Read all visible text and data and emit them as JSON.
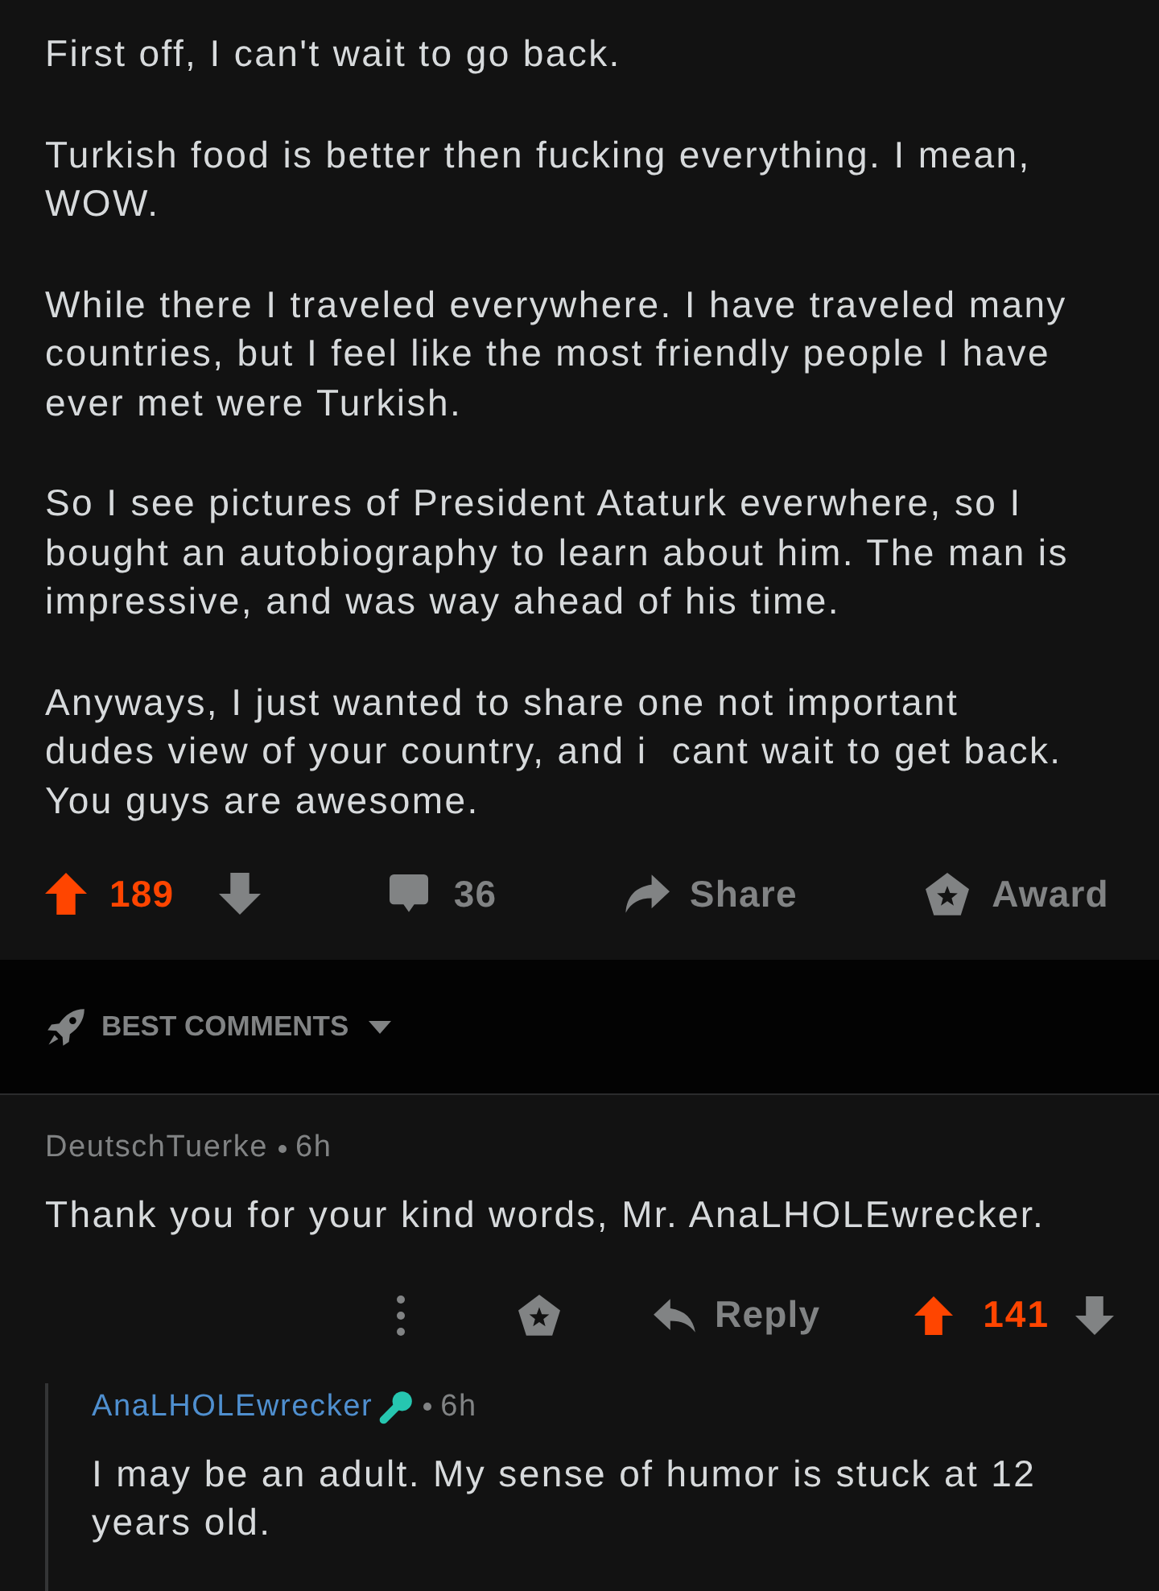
{
  "post": {
    "paragraphs": [
      "First off, I can't wait to go back.",
      "Turkish food is better then fucking everything. I mean, WOW.",
      "While there I traveled everywhere. I have traveled many countries, but I feel like the most friendly people I have ever met were Turkish.",
      "So I see pictures of President Ataturk everwhere, so I bought an autobiography to learn about him. The man is impressive, and was way ahead of his time.",
      "Anyways, I just wanted to share one not important dudes view of your country, and i  cant wait to get back. You guys are awesome."
    ]
  },
  "post_actions": {
    "upvoted": true,
    "score": "189",
    "comment_count": "36",
    "share_label": "Share",
    "award_label": "Award"
  },
  "sort": {
    "label": "BEST COMMENTS"
  },
  "comments": [
    {
      "author": "DeutschTuerke",
      "is_op": false,
      "badge": false,
      "age": "6h",
      "body": "Thank you for your kind words, Mr. AnaLHOLEwrecker.",
      "upvoted": true,
      "score": "141",
      "reply_label": "Reply",
      "children": [
        {
          "author": "AnaLHOLEwrecker",
          "is_op": true,
          "badge": true,
          "age": "6h",
          "body": "I may be an adult. My sense of humor is stuck at 12 years old."
        }
      ]
    }
  ]
}
